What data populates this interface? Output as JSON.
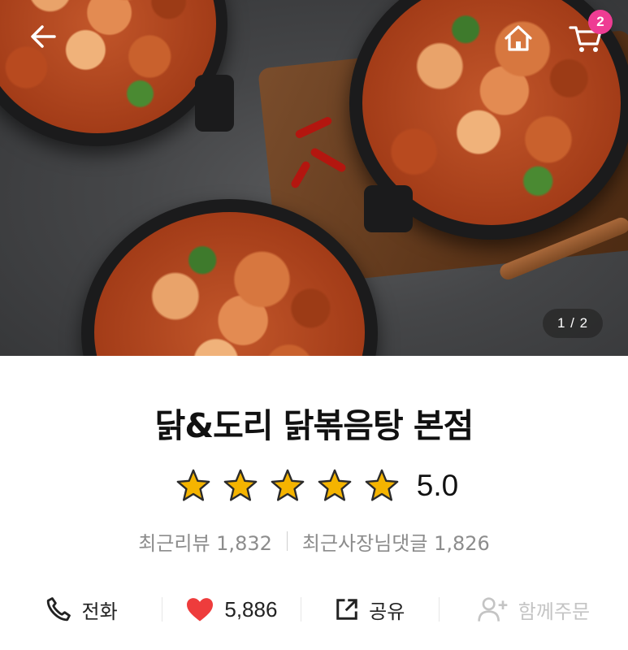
{
  "header": {
    "back_icon": "arrow-left-icon",
    "home_icon": "home-icon",
    "cart_icon": "cart-icon",
    "cart_badge": "2",
    "badge_color": "#ee3c93"
  },
  "gallery": {
    "page_indicator": "1 / 2",
    "current_page": 1,
    "total_pages": 2
  },
  "store": {
    "name": "닭&도리 닭볶음탕 본점",
    "rating": "5.0",
    "star_count": 5,
    "star_color": "#f5b400",
    "recent_reviews": "최근리뷰 1,832",
    "recent_owner_replies": "최근사장님댓글 1,826"
  },
  "actions": {
    "call_label": "전화",
    "call_icon": "phone-icon",
    "like_count": "5,886",
    "like_icon": "heart-icon",
    "like_color": "#ee3c3c",
    "share_label": "공유",
    "share_icon": "share-icon",
    "group_order_label": "함께주문",
    "group_order_icon": "add-person-icon",
    "group_order_disabled_color": "#c4c4c4"
  }
}
